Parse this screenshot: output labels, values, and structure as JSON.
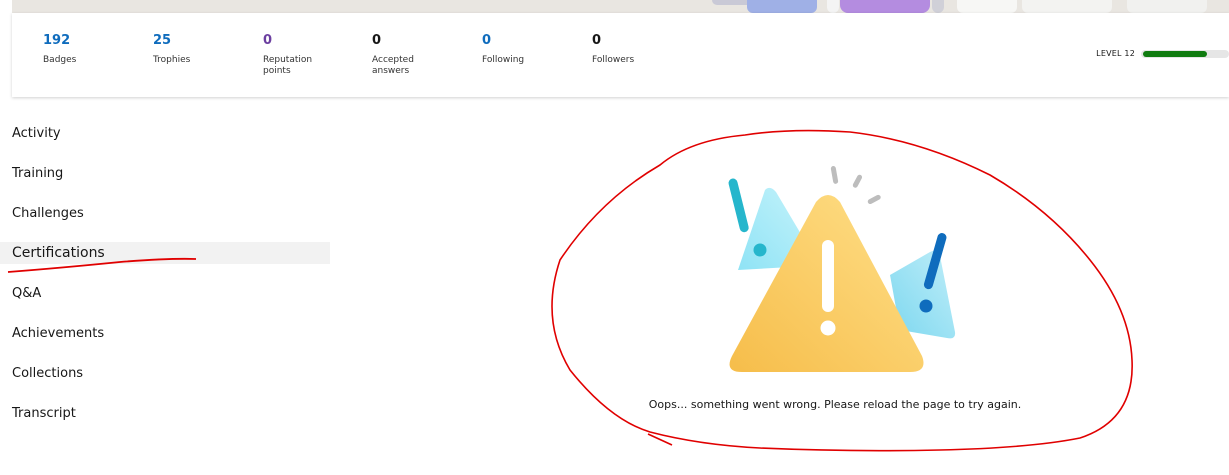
{
  "stats": [
    {
      "value": "192",
      "label": "Badges",
      "color": "#0f6cbd"
    },
    {
      "value": "25",
      "label": "Trophies",
      "color": "#0f6cbd"
    },
    {
      "value": "0",
      "label": "Reputation points",
      "color": "#6b3fa0"
    },
    {
      "value": "0",
      "label": "Accepted answers",
      "color": "#171717"
    },
    {
      "value": "0",
      "label": "Following",
      "color": "#0f6cbd"
    },
    {
      "value": "0",
      "label": "Followers",
      "color": "#171717"
    }
  ],
  "level": {
    "label": "LEVEL 12",
    "progress_percent": 76,
    "bar_color": "#107c10"
  },
  "sidebar": {
    "items": [
      {
        "label": "Activity"
      },
      {
        "label": "Training"
      },
      {
        "label": "Challenges"
      },
      {
        "label": "Certifications",
        "active": true
      },
      {
        "label": "Q&A"
      },
      {
        "label": "Achievements"
      },
      {
        "label": "Collections"
      },
      {
        "label": "Transcript"
      }
    ]
  },
  "error": {
    "message": "Oops... something went wrong. Please reload the page to try again.",
    "icon": "warning-triangle-icon"
  },
  "annotation_color": "#e00000"
}
